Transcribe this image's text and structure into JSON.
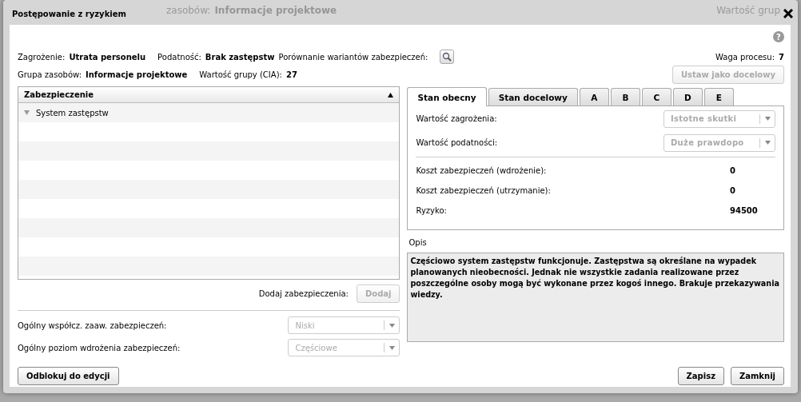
{
  "background": {
    "group_label": "zasobów:",
    "group": "Informacje projektowe",
    "group_value_label": "Wartość grup"
  },
  "window": {
    "title": "Postępowanie z ryzykiem",
    "help": "?"
  },
  "info": {
    "threat_label": "Zagrożenie:",
    "threat": "Utrata personelu",
    "vuln_label": "Podatność:",
    "vuln": "Brak zastępstw",
    "compare_label": "Porównanie wariantów zabezpieczeń:",
    "weight_label": "Waga procesu:",
    "weight": "7",
    "group_label": "Grupa zasobów:",
    "group": "Informacje projektowe",
    "group_value_label": "Wartość grupy (CIA):",
    "group_value": "27"
  },
  "set_target_button": {
    "label": "Ustaw jako docelowy",
    "disabled": true
  },
  "grid": {
    "column": "Zabezpieczenie",
    "rows": [
      {
        "label": "System zastępstw",
        "expanded": true
      }
    ]
  },
  "add": {
    "label": "Dodaj zabezpieczenia:",
    "button": "Dodaj",
    "disabled": true
  },
  "overall": [
    {
      "label": "Ogólny współcz. zaaw. zabezpieczeń:",
      "value": "Niski",
      "disabled": true
    },
    {
      "label": "Ogólny poziom wdrożenia zabezpieczeń:",
      "value": "Częściowe",
      "disabled": true
    }
  ],
  "tabs": [
    {
      "label": "Stan obecny",
      "selected": true
    },
    {
      "label": "Stan docelowy",
      "selected": false
    },
    {
      "label": "A",
      "selected": false
    },
    {
      "label": "B",
      "selected": false
    },
    {
      "label": "C",
      "selected": false
    },
    {
      "label": "D",
      "selected": false
    },
    {
      "label": "E",
      "selected": false
    }
  ],
  "fields": [
    {
      "label": "Wartość zagrożenia:",
      "value": "Istotne skutki",
      "disabled": true
    },
    {
      "label": "Wartość podatności:",
      "value": "Duże prawdopo",
      "disabled": true
    }
  ],
  "costs": [
    {
      "label": "Koszt zabezpieczeń (wdrożenie):",
      "value": "0"
    },
    {
      "label": "Koszt zabezpieczeń (utrzymanie):",
      "value": "0"
    },
    {
      "label": "Ryzyko:",
      "value": "94500"
    }
  ],
  "description": {
    "label": "Opis",
    "text": "Częściowo system zastępstw funkcjonuje. Zastępstwa są określane na wypadek planowanych nieobecności. Jednak nie wszystkie zadania realizowane przez poszczególne osoby mogą być wykonane przez kogoś innego. Brakuje przekazywania wiedzy."
  },
  "buttons": {
    "unlock": "Odblokuj do edycji",
    "save": "Zapisz",
    "close": "Zamknij"
  }
}
